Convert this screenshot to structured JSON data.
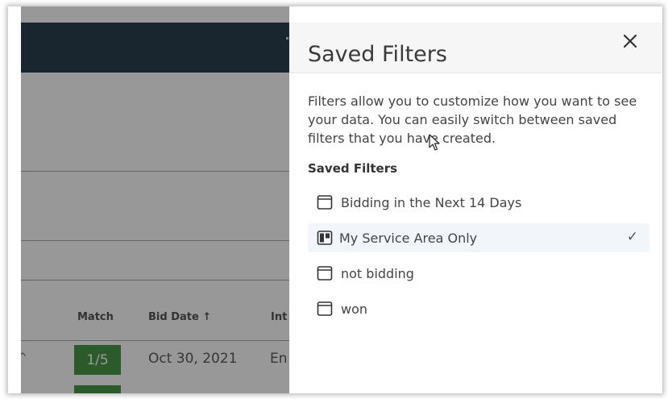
{
  "panel": {
    "title": "Saved Filters",
    "description": "Filters allow you to customize how you want to see your data. You can easily switch between saved filters that you have created.",
    "section_label": "Saved Filters",
    "filters": [
      {
        "label": "Bidding in the Next 14 Days",
        "icon": "window-icon",
        "selected": false
      },
      {
        "label": "My Service Area Only",
        "icon": "board-icon",
        "selected": true
      },
      {
        "label": "not bidding",
        "icon": "window-icon",
        "selected": false
      },
      {
        "label": "won",
        "icon": "window-icon",
        "selected": false
      }
    ],
    "close_icon": "close-icon",
    "selected_icon": "checkmark-icon"
  },
  "background": {
    "columns": [
      "Match",
      "Bid Date ↑",
      "Int"
    ],
    "row": {
      "match": "1/5",
      "bid_date": "Oct 30, 2021",
      "next": "En"
    },
    "stray_glyph": "^"
  },
  "colors": {
    "topbar": "#0e2636",
    "match_badge": "#2f8a2f",
    "selected_row": "#f2f6fa",
    "panel_header": "#f6f6f6"
  }
}
